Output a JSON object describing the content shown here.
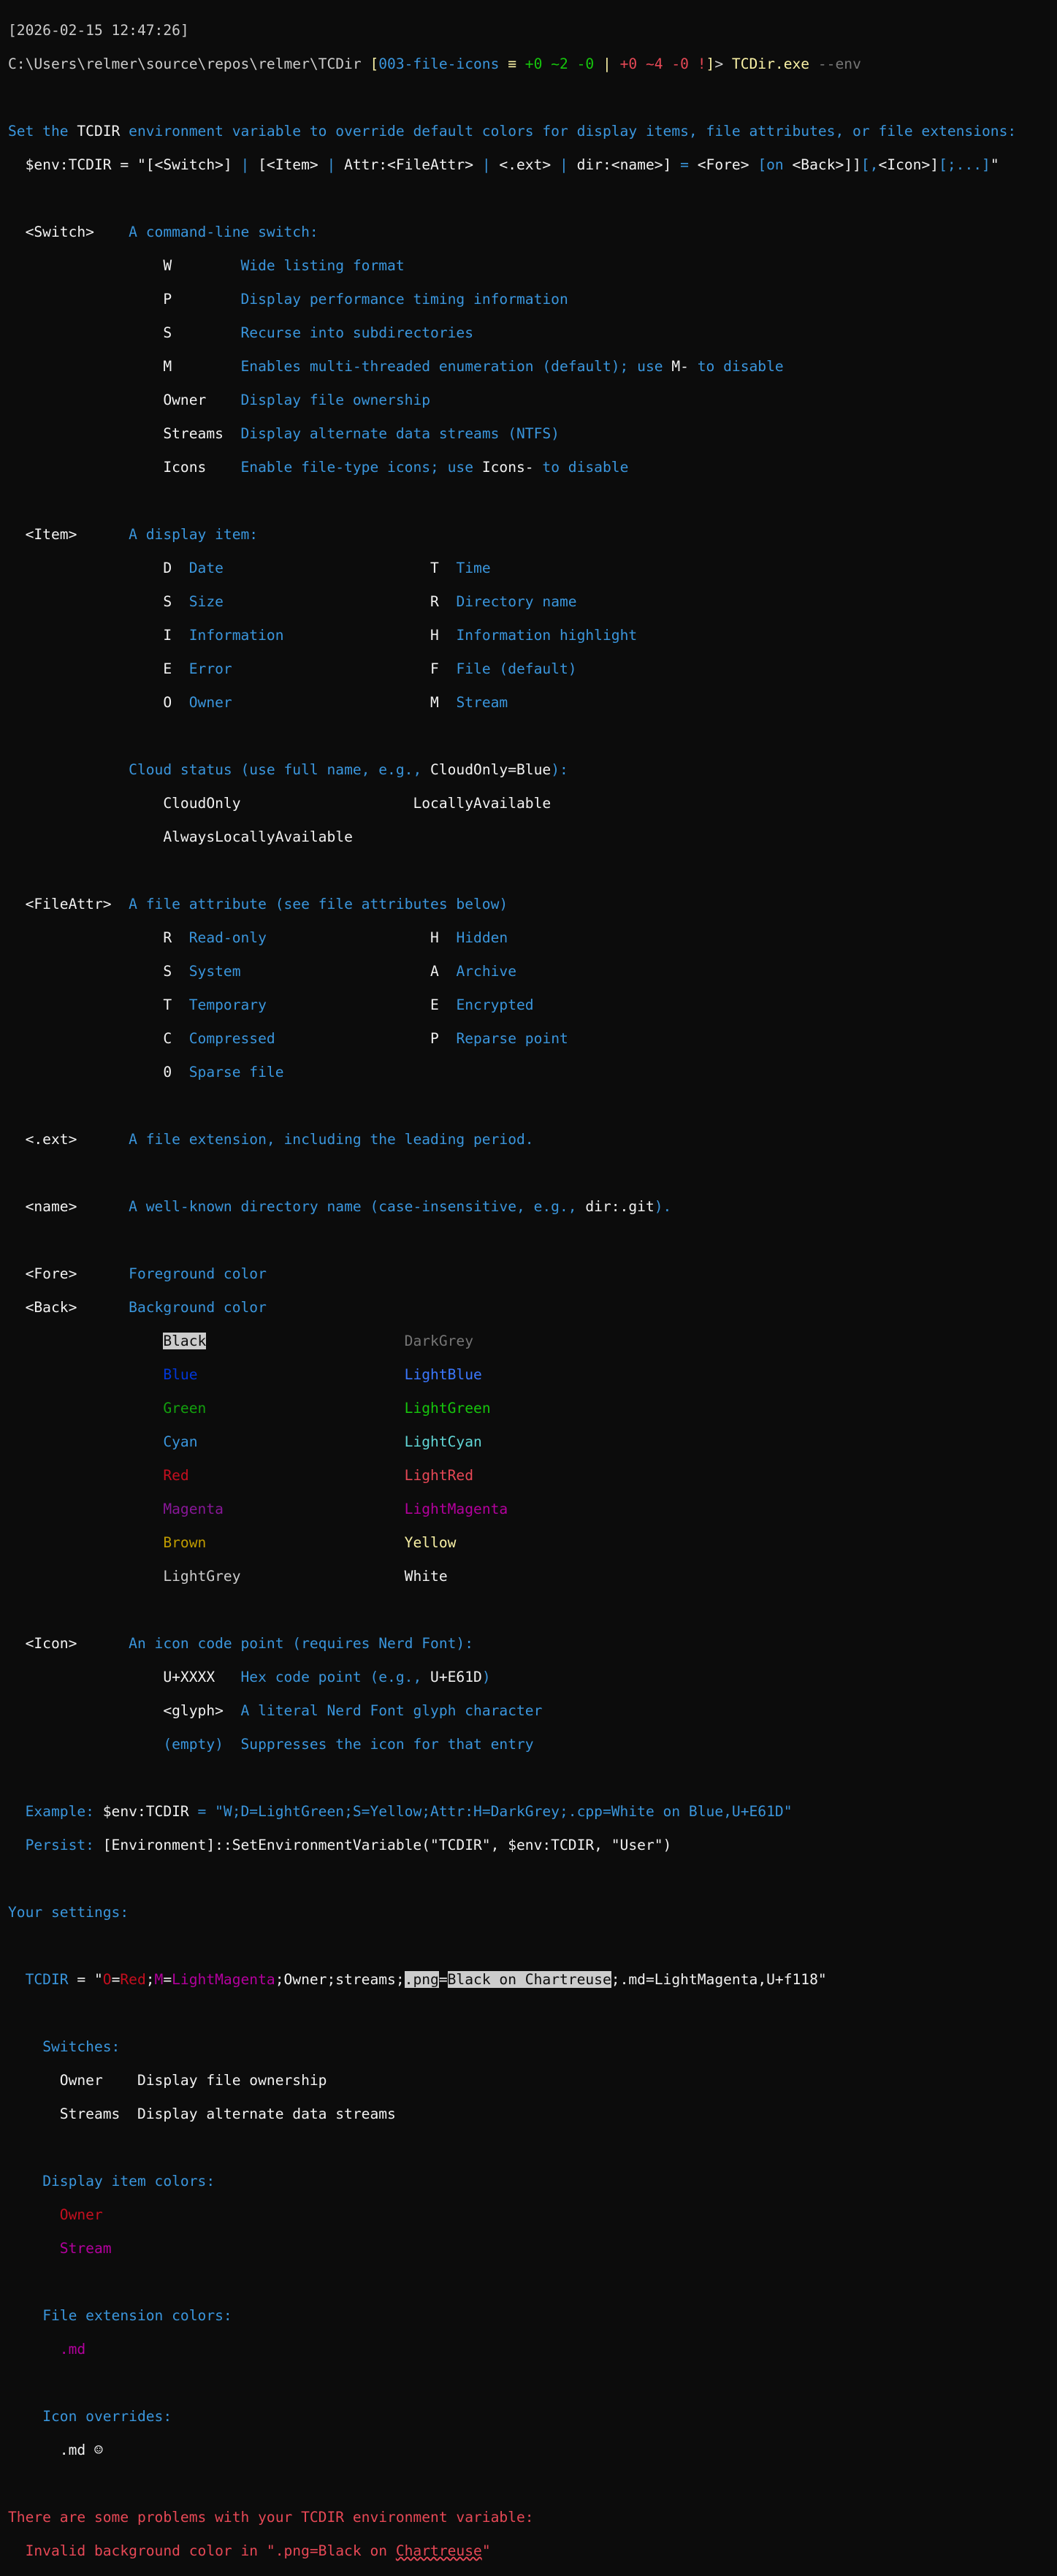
{
  "colors": {
    "background": "#0c0c0c",
    "text": "#cccccc",
    "bright_text": "#f2f2f2",
    "help_blue": "#3a96dd",
    "error": "#e74856"
  },
  "header": {
    "timestamp": "[2026-02-15 12:47:26]",
    "prompt_path": "C:\\Users\\relmer\\source\\repos\\relmer\\TCDir",
    "git_open": " [",
    "git_branch": "003-file-icons",
    "git_sep1": " ≡ ",
    "git_index_added": "+0",
    "git_index_modified": "~2",
    "git_index_deleted": "-0",
    "git_pipe": " | ",
    "git_work_added": "+0",
    "git_work_modified": "~4",
    "git_work_deleted": "-0",
    "git_work_flag": "!",
    "git_close": "]",
    "prompt_char": "> ",
    "command": "TCDir.exe",
    "argument": "--env"
  },
  "intro": {
    "line1_a": "Set the ",
    "line1_var": "TCDIR",
    "line1_b": " environment variable to override default colors for display items, file attributes, or file extensions:",
    "syntax": {
      "p1": "  $env:TCDIR = \"[<Switch>] ",
      "p2": "| ",
      "p3": "[<Item> ",
      "p4": "| ",
      "p5": "Attr:<FileAttr> ",
      "p6": "| ",
      "p7": "<.ext> ",
      "p8": "| ",
      "p9": "dir:<name>] ",
      "p10": "= ",
      "p11": "<Fore> ",
      "p12": "[on ",
      "p13": "<Back>]]",
      "p14": "[,",
      "p15": "<Icon>]",
      "p16": "[;...]",
      "p17": "\""
    }
  },
  "switch_section": {
    "label": "<Switch>",
    "desc": "A command-line switch:",
    "items": [
      {
        "key": "W",
        "desc": "Wide listing format"
      },
      {
        "key": "P",
        "desc": "Display performance timing information"
      },
      {
        "key": "S",
        "desc": "Recurse into subdirectories"
      },
      {
        "key": "Owner",
        "desc": "Display file ownership"
      },
      {
        "key": "Streams",
        "desc": "Display alternate data streams (NTFS)"
      }
    ],
    "m_key": "M",
    "m_desc_a": "Enables multi-threaded enumeration (default); use ",
    "m_desc_b": "M-",
    "m_desc_c": " to disable",
    "icons_key": "Icons",
    "icons_desc_a": "Enable file-type icons; use ",
    "icons_desc_b": "Icons-",
    "icons_desc_c": " to disable"
  },
  "item_section": {
    "label": "<Item>",
    "desc": "A display item:",
    "rows": [
      {
        "k1": "D",
        "d1": "Date",
        "k2": "T",
        "d2": "Time"
      },
      {
        "k1": "S",
        "d1": "Size",
        "k2": "R",
        "d2": "Directory name"
      },
      {
        "k1": "I",
        "d1": "Information",
        "k2": "H",
        "d2": "Information highlight"
      },
      {
        "k1": "E",
        "d1": "Error",
        "k2": "F",
        "d2": "File (default)"
      },
      {
        "k1": "O",
        "d1": "Owner",
        "k2": "M",
        "d2": "Stream"
      }
    ],
    "cloud_a": "Cloud status (use full name, e.g., ",
    "cloud_b": "CloudOnly=Blue",
    "cloud_c": "):",
    "cloud_row1_a": "CloudOnly",
    "cloud_row1_b": "LocallyAvailable",
    "cloud_row2_a": "AlwaysLocallyAvailable"
  },
  "fileattr_section": {
    "label": "<FileAttr>",
    "desc": "A file attribute (see file attributes below)",
    "rows": [
      {
        "k1": "R",
        "d1": "Read-only",
        "k2": "H",
        "d2": "Hidden"
      },
      {
        "k1": "S",
        "d1": "System",
        "k2": "A",
        "d2": "Archive"
      },
      {
        "k1": "T",
        "d1": "Temporary",
        "k2": "E",
        "d2": "Encrypted"
      },
      {
        "k1": "C",
        "d1": "Compressed",
        "k2": "P",
        "d2": "Reparse point"
      }
    ],
    "last_key": "0",
    "last_desc": "Sparse file"
  },
  "ext_section": {
    "label": "<.ext>",
    "desc": "A file extension, including the leading period."
  },
  "name_section": {
    "label": "<name>",
    "desc_a": "A well-known directory name (case-insensitive, e.g., ",
    "desc_b": "dir:.git",
    "desc_c": ")."
  },
  "color_section": {
    "fore_label": "<Fore>",
    "fore_desc": "Foreground color",
    "back_label": "<Back>",
    "back_desc": "Background color",
    "rows": [
      {
        "left": "Black",
        "right": "DarkGrey"
      },
      {
        "left": "Blue",
        "right": "LightBlue"
      },
      {
        "left": "Green",
        "right": "LightGreen"
      },
      {
        "left": "Cyan",
        "right": "LightCyan"
      },
      {
        "left": "Red",
        "right": "LightRed"
      },
      {
        "left": "Magenta",
        "right": "LightMagenta"
      },
      {
        "left": "Brown",
        "right": "Yellow"
      },
      {
        "left": "LightGrey",
        "right": "White"
      }
    ]
  },
  "icon_section": {
    "label": "<Icon>",
    "desc": "An icon code point (requires Nerd Font):",
    "r1_key": "U+XXXX",
    "r1_desc_a": "Hex code point (e.g., ",
    "r1_desc_b": "U+E61D",
    "r1_desc_c": ")",
    "r2_key": "<glyph>",
    "r2_desc": "A literal Nerd Font glyph character",
    "r3_key": "(empty)",
    "r3_desc": "Suppresses the icon for that entry"
  },
  "examples": {
    "example_label": "Example: ",
    "example_a": "$env:TCDIR",
    "example_b": " = ",
    "example_c": "\"W;D=LightGreen;S=Yellow;Attr:H=DarkGrey;.cpp=White on Blue,U+E61D\"",
    "persist_label": "Persist: ",
    "persist_text": "[Environment]::SetEnvironmentVariable(\"TCDIR\", $env:TCDIR, \"User\")"
  },
  "settings": {
    "heading": "Your settings:",
    "tcdir_label": "TCDIR",
    "tcdir_eq": " = \"",
    "t_o": "O",
    "t_eq1": "=",
    "t_red": "Red",
    "t_semi1": ";",
    "t_m": "M",
    "t_eq2": "=",
    "t_lm": "LightMagenta",
    "t_mid": ";Owner;streams;",
    "t_png": ".png",
    "t_eq3": "=",
    "t_bad": "Black on Chartreuse",
    "t_tail": ";.md=LightMagenta,U+f118\"",
    "switches_heading": "Switches:",
    "switches": [
      {
        "key": "Owner",
        "desc": "Display file ownership"
      },
      {
        "key": "Streams",
        "desc": "Display alternate data streams"
      }
    ],
    "item_heading": "Display item colors:",
    "item_owner": "Owner",
    "item_stream": "Stream",
    "ext_heading": "File extension colors:",
    "ext_md": ".md",
    "icon_heading": "Icon overrides:",
    "icon_md": ".md",
    "icon_glyph": "☺"
  },
  "errors": {
    "heading": "There are some problems with your TCDIR environment variable:",
    "line_a": "  Invalid background color in \".png=Black on ",
    "line_bad": "Chartreuse",
    "line_c": "\""
  }
}
